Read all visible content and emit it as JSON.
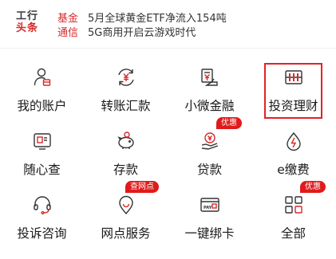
{
  "news": {
    "logo_line1": "工行",
    "logo_line2": "头条",
    "items": [
      {
        "tag": "基金",
        "text": "5月全球黄金ETF净流入154吨"
      },
      {
        "tag": "通信",
        "text": "5G商用开启云游戏时代"
      }
    ]
  },
  "services": [
    {
      "label": "我的账户",
      "icon": "account-person-icon",
      "badge": ""
    },
    {
      "label": "转账汇款",
      "icon": "transfer-yuan-icon",
      "badge": ""
    },
    {
      "label": "小微金融",
      "icon": "small-finance-icon",
      "badge": ""
    },
    {
      "label": "投资理财",
      "icon": "investment-abacus-icon",
      "badge": ""
    },
    {
      "label": "随心查",
      "icon": "query-card-icon",
      "badge": ""
    },
    {
      "label": "存款",
      "icon": "piggy-bank-icon",
      "badge": ""
    },
    {
      "label": "贷款",
      "icon": "loan-hand-icon",
      "badge": "优惠"
    },
    {
      "label": "e缴费",
      "icon": "payment-drop-icon",
      "badge": ""
    },
    {
      "label": "投诉咨询",
      "icon": "headset-icon",
      "badge": ""
    },
    {
      "label": "网点服务",
      "icon": "location-pin-icon",
      "badge": "查网点"
    },
    {
      "label": "一键绑卡",
      "icon": "bind-card-icon",
      "badge": ""
    },
    {
      "label": "全部",
      "icon": "all-grid-icon",
      "badge": "优惠"
    }
  ],
  "colors": {
    "accent": "#d62a2a",
    "badge": "#e01a1a",
    "highlight": "#e32222"
  }
}
